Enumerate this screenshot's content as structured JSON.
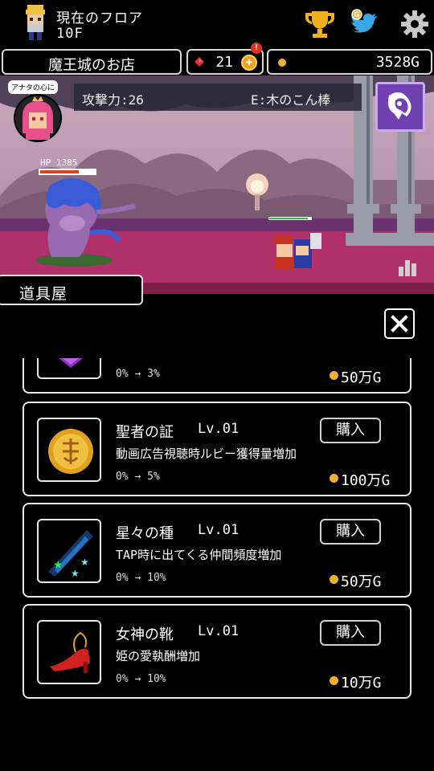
{
  "header": {
    "floor_label": "現在のフロア",
    "floor_value": "10F",
    "icons": [
      "player-avatar-icon",
      "trophy-icon",
      "twitter-bird-icon",
      "gear-icon"
    ]
  },
  "status": {
    "shop_name": "魔王城のお店",
    "ruby_count": "21",
    "ruby_plus": "+",
    "ruby_alert": "!",
    "gold": "3528G"
  },
  "battle": {
    "bubble_text": "アナタの心に",
    "attack_label": "攻撃力:26",
    "equipped": "E:木のこん棒",
    "enemy_hp_label": "HP 1385",
    "enemy_hp_fraction": 0.7,
    "hero_hp_fraction": 0.9
  },
  "shop": {
    "tab_label": "道具屋",
    "close_label": "×",
    "items": [
      {
        "name": "",
        "level": "",
        "description": "",
        "rate": "0% → 3%",
        "price": "50万G",
        "buy_label": "",
        "icon": "purple-gem-icon"
      },
      {
        "name": "聖者の証",
        "level": "Lv.01",
        "description": "動画広告視聴時ルビー獲得量増加",
        "rate": "0% → 5%",
        "price": "100万G",
        "buy_label": "購入",
        "icon": "gold-medal-icon"
      },
      {
        "name": "星々の種",
        "level": "Lv.01",
        "description": "TAP時に出てくる仲間頻度増加",
        "rate": "0% → 10%",
        "price": "50万G",
        "buy_label": "購入",
        "icon": "star-seeds-icon"
      },
      {
        "name": "女神の靴",
        "level": "Lv.01",
        "description": "姫の愛執酬増加",
        "rate": "0% → 10%",
        "price": "10万G",
        "buy_label": "購入",
        "icon": "red-heel-shoe-icon"
      }
    ]
  },
  "colors": {
    "background": "#000000",
    "gold": "#f0b030",
    "ruby": "#e03040",
    "skill_purple": "#7040b0",
    "floor_magenta": "#b0306a"
  }
}
